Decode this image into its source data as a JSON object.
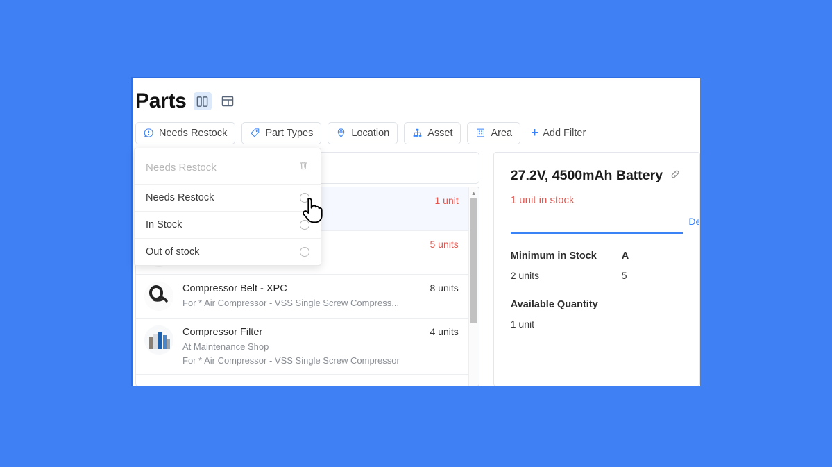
{
  "window": {
    "title": "Parts",
    "view_toggles": [
      {
        "icon": "split-columns-icon",
        "active": true
      },
      {
        "icon": "panel-layout-icon",
        "active": false
      }
    ]
  },
  "filter_bar": {
    "chips": [
      {
        "label": "Needs Restock",
        "icon": "alert-circle-icon"
      },
      {
        "label": "Part Types",
        "icon": "tag-icon"
      },
      {
        "label": "Location",
        "icon": "map-pin-icon"
      },
      {
        "label": "Asset",
        "icon": "sitemap-icon"
      },
      {
        "label": "Area",
        "icon": "building-icon"
      }
    ],
    "add_filter_label": "Add Filter",
    "add_filter_icon": "plus-icon"
  },
  "dropdown": {
    "title": "Needs Restock",
    "delete_icon": "trash-icon",
    "options": [
      {
        "label": "Needs Restock",
        "selected": false
      },
      {
        "label": "In Stock",
        "selected": false
      },
      {
        "label": "Out of stock",
        "selected": false
      }
    ]
  },
  "list_pane": {
    "search": {
      "value": "",
      "placeholder": ""
    },
    "scrollbar": {
      "up_arrow_icon": "chevron-up-icon"
    },
    "rows": [
      {
        "name": "",
        "sub1": "",
        "sub2": "",
        "qty": "1 unit",
        "qty_low": true,
        "selected": true
      },
      {
        "name": "",
        "sub1": "",
        "sub2": "",
        "qty": "5 units",
        "qty_low": true,
        "selected": false
      },
      {
        "name": "Compressor Belt - XPC",
        "sub1": "For * Air Compressor - VSS Single Screw Compress...",
        "sub2": "",
        "qty": "8 units",
        "qty_low": false,
        "selected": false
      },
      {
        "name": "Compressor Filter",
        "sub1": "At Maintenance Shop",
        "sub2": "For * Air Compressor - VSS Single Screw Compressor",
        "qty": "4 units",
        "qty_low": false,
        "selected": false
      }
    ]
  },
  "detail_pane": {
    "title": "27.2V, 4500mAh Battery",
    "link_icon": "link-icon",
    "stock_status": "1 unit in stock",
    "tabs": [
      {
        "label": "Deta",
        "active": true
      }
    ],
    "fields": [
      {
        "label": "Minimum in Stock",
        "value": "2 units"
      },
      {
        "label": "Available Quantity",
        "value": "1 unit"
      }
    ],
    "fields_right": [
      {
        "label": "A",
        "value": "5"
      }
    ]
  },
  "colors": {
    "desktop_background": "#3f80f5",
    "accent": "#3b82f6",
    "low_stock": "#e0574f"
  }
}
